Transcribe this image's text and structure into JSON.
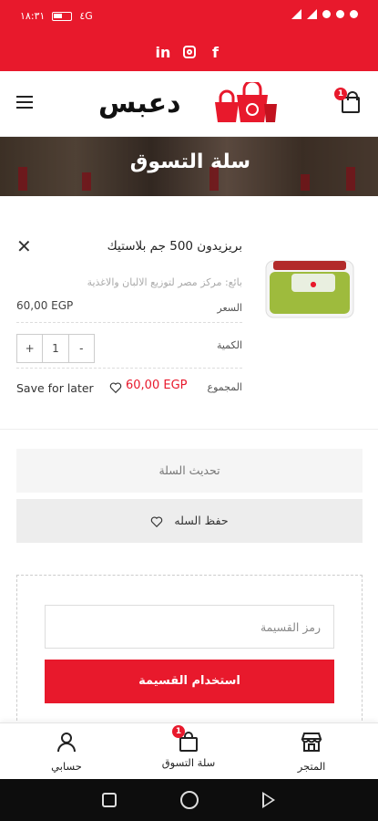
{
  "status_bar": {
    "time": "١٨:٣١",
    "network": "٤G",
    "battery_label": ""
  },
  "social": {
    "items": [
      "in",
      "ig",
      "f"
    ]
  },
  "header": {
    "logo_text": "دعبس",
    "cart_count": "1",
    "menu_icon": "hamburger-icon",
    "cart_icon": "shopping-bag-icon"
  },
  "banner": {
    "title": "سلة التسوق"
  },
  "cart_item": {
    "name": "بريزيدون 500 جم بلاستيك",
    "seller": "بائع: مركز مصر لتوزيع الالبان والاغذية",
    "price_label": "السعر",
    "price": "60,00 EGP",
    "quantity_label": "الكمية",
    "quantity": "1",
    "qty_minus": "-",
    "qty_plus": "+",
    "total_label": "المجموع",
    "total": "60,00 EGP",
    "save_for_later": "Save for later"
  },
  "actions": {
    "update_cart": "تحديث السلة",
    "save_cart": "حفظ السله"
  },
  "coupon": {
    "placeholder": "رمز القسيمة",
    "apply_label": "استخدام القسيمة"
  },
  "bottom_nav": {
    "items": [
      {
        "label": "حسابي",
        "icon": "user-icon"
      },
      {
        "label": "سلة التسوق",
        "icon": "shopping-bag-icon",
        "badge": "1"
      },
      {
        "label": "المتجر",
        "icon": "store-icon"
      }
    ]
  },
  "colors": {
    "brand_red": "#e8192c",
    "dark": "#222222"
  }
}
